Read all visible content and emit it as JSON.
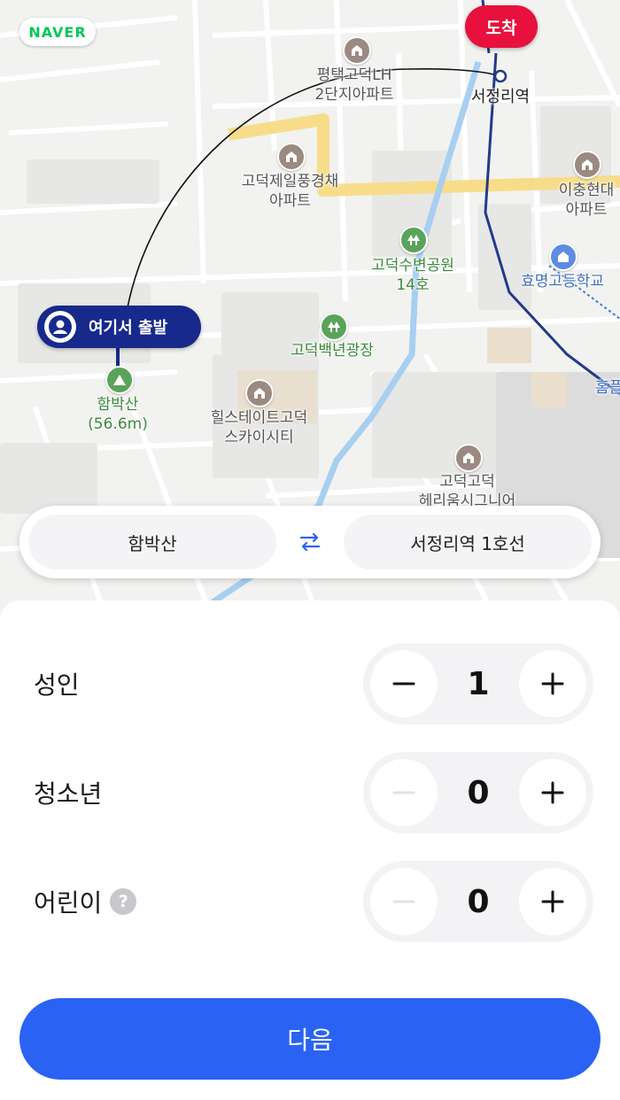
{
  "map": {
    "brand": "NAVER",
    "arrival_badge": "도착",
    "departure_badge": "여기서 출발",
    "labels": {
      "apt1": "평택고덕LH\n2단지아파트",
      "station": "서정리역",
      "apt2": "고덕제일풍경채\n아파트",
      "apt3": "이충현대\n아파트",
      "park1": "고덕수변공원\n14호",
      "school": "효명고등학교",
      "park2": "고덕백년광장",
      "mountain": "함박산\n(56.6m)",
      "apt4": "힐스테이트고덕\n스카이시티",
      "apt5": "고덕고덕\n헤리움시그니어",
      "edge": "홈플"
    }
  },
  "route": {
    "from": "함박산",
    "to": "서정리역 1호선",
    "swap_icon": "swap-arrows-icon"
  },
  "passengers": [
    {
      "label": "성인",
      "count": "1",
      "minus_enabled": true,
      "has_help": false
    },
    {
      "label": "청소년",
      "count": "0",
      "minus_enabled": false,
      "has_help": false
    },
    {
      "label": "어린이",
      "count": "0",
      "minus_enabled": false,
      "has_help": true
    }
  ],
  "help_glyph": "?",
  "next_label": "다음",
  "colors": {
    "accent": "#2a63f4",
    "arrival": "#e8103c",
    "departure": "#172a8c",
    "park": "#3b8b3b",
    "subway_line": "#233a8a"
  }
}
